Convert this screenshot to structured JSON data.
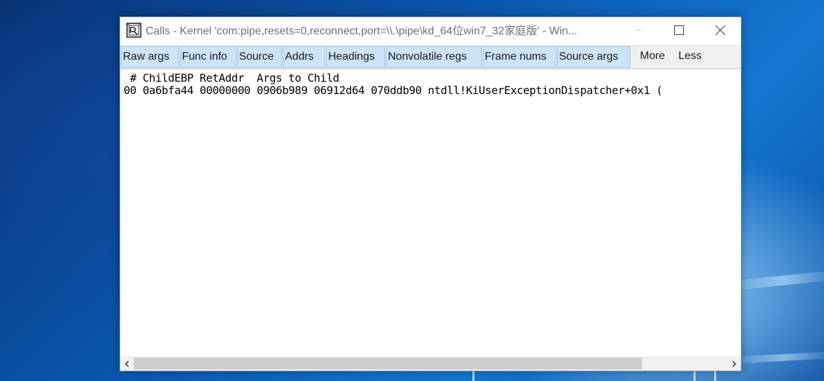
{
  "window": {
    "title": "Calls - Kernel 'com:pipe,resets=0,reconnect,port=\\\\.\\pipe\\kd_64位win7_32家庭版' - Win...",
    "caption_buttons": {
      "minimize": "—",
      "maximize": "☐",
      "close": "✕"
    }
  },
  "toolbar": {
    "buttons": [
      {
        "label": "Raw args"
      },
      {
        "label": "Func info"
      },
      {
        "label": "Source"
      },
      {
        "label": "Addrs"
      },
      {
        "label": "Headings"
      },
      {
        "label": "Nonvolatile regs"
      },
      {
        "label": "Frame nums"
      },
      {
        "label": "Source args"
      }
    ],
    "more_label": "More",
    "less_label": "Less"
  },
  "callstack": {
    "header": " # ChildEBP RetAddr  Args to Child",
    "rows": [
      "00 0a6bfa44 00000000 0906b989 06912d64 070ddb90 ntdll!KiUserExceptionDispatcher+0x1 ("
    ]
  },
  "scrollbar": {
    "left_arrow": "‹",
    "right_arrow": "›"
  },
  "colors": {
    "toggle_bg": "#cce4f7",
    "toggle_border": "#9dc4e6",
    "desktop_blue": "#0a56ad",
    "title_text": "#6f6f6f"
  },
  "icons": [
    "calls-window-icon",
    "minimize-icon",
    "maximize-icon",
    "close-icon",
    "chevron-left-icon",
    "chevron-right-icon"
  ]
}
